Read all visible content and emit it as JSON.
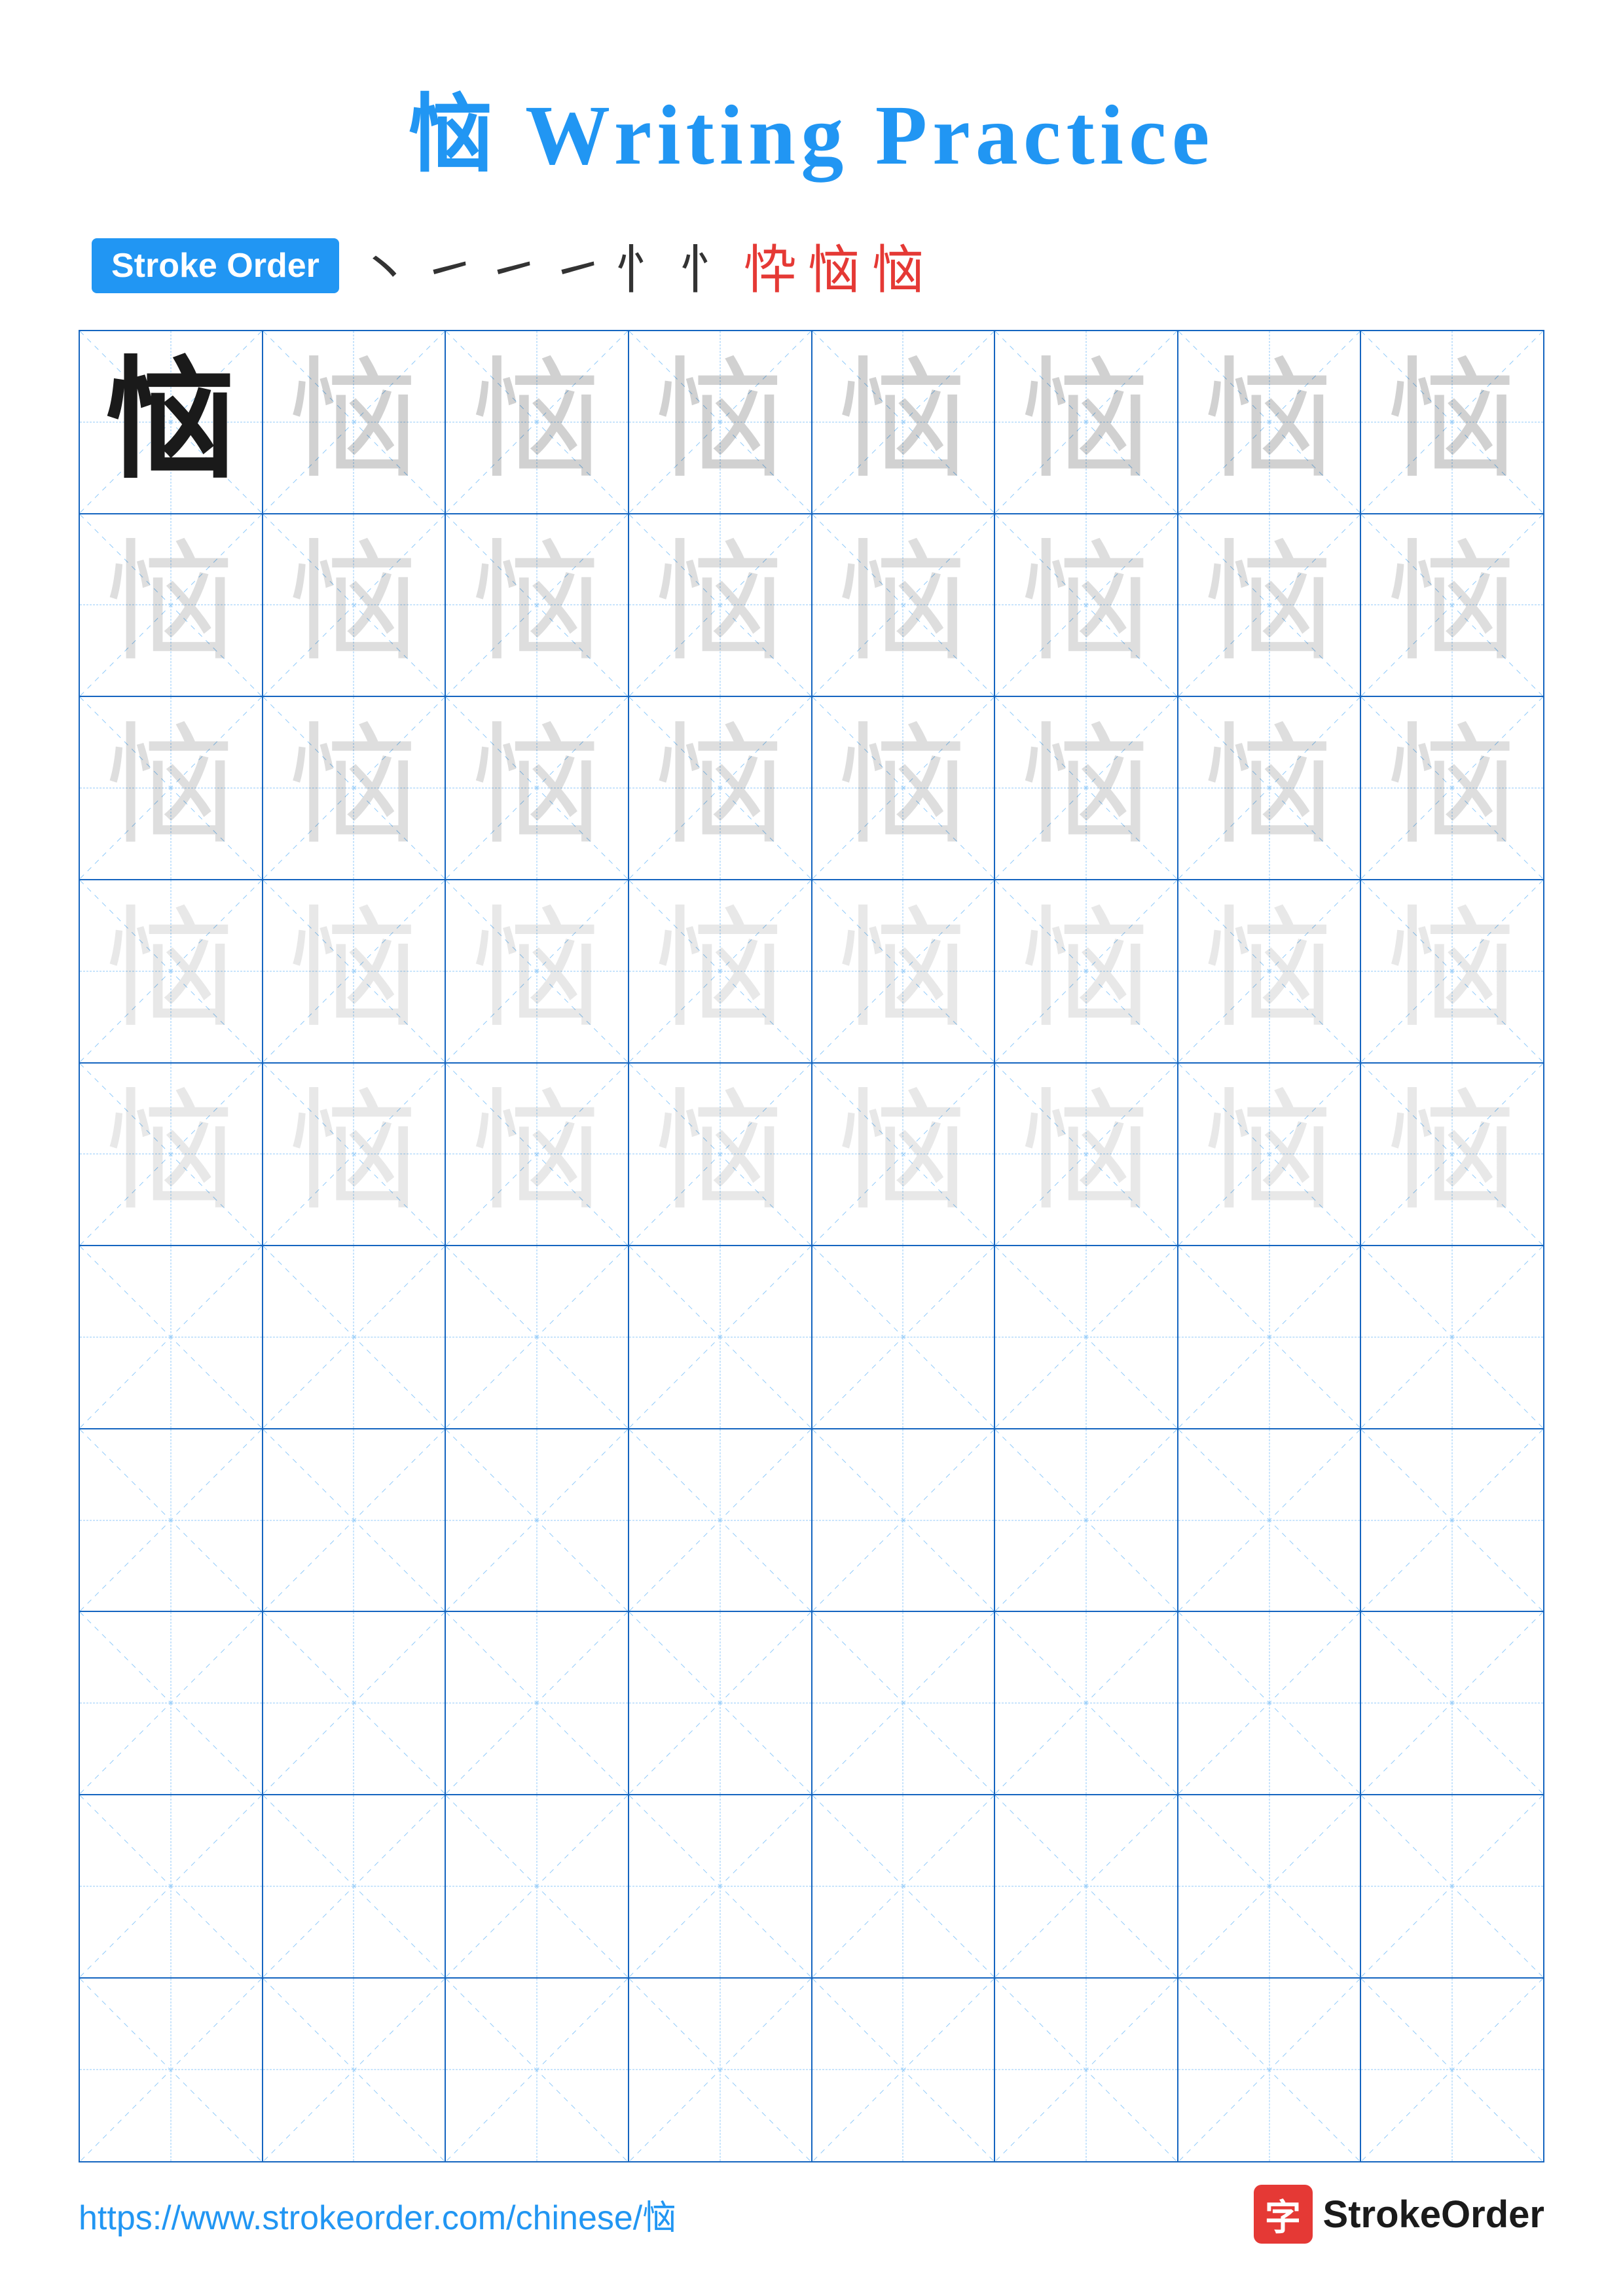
{
  "title": "恼 Writing Practice",
  "stroke_order": {
    "badge_label": "Stroke Order",
    "strokes": [
      "丶",
      "㇀",
      "㇀",
      "㇀",
      "忄",
      "忄",
      "忰",
      "恼",
      "恼"
    ]
  },
  "character": "恼",
  "grid": {
    "cols": 8,
    "rows": 10,
    "practice_rows_with_char": 5,
    "empty_rows": 5
  },
  "footer": {
    "url": "https://www.strokeorder.com/chinese/恼",
    "logo_char": "字",
    "logo_text": "StrokeOrder"
  }
}
